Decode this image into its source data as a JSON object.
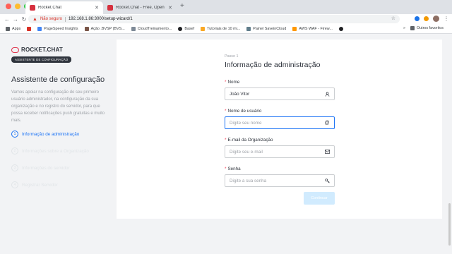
{
  "browser": {
    "tabs": [
      {
        "title": "Rocket.Chat",
        "active": true
      },
      {
        "title": "Rocket.Chat - Free, Open Sou",
        "active": false
      }
    ],
    "not_secure": "Não seguro",
    "url": "192.168.1.86:3000/setup-wizard/1",
    "bookmarks": [
      {
        "label": "Apps",
        "color": "#5f6368"
      },
      {
        "label": "",
        "color": "#d93025"
      },
      {
        "label": "PageSpeed Insights",
        "color": "#4285f4"
      },
      {
        "label": "Ação .BVSP (BVS...",
        "color": "#795548"
      },
      {
        "label": "CloudTreinamento...",
        "color": "#7e8a97"
      },
      {
        "label": "Basef",
        "color": "#202124"
      },
      {
        "label": "Tutoriais de 10 mi...",
        "color": "#f9a825"
      },
      {
        "label": "Painel SaveinCloud",
        "color": "#607d8b"
      },
      {
        "label": "AWS WAF - Firew...",
        "color": "#ff9800"
      },
      {
        "label": "",
        "color": "#202124"
      }
    ],
    "others_label": "Outros favoritos"
  },
  "sidebar": {
    "logo_text": "ROCKET.CHAT",
    "badge": "ASSISTENTE DE CONFIGURAÇÃO",
    "title": "Assistente de configuração",
    "description": "Vamos apoiar na configuração do seu primeiro usuário administrador, na configuração da sua organização e no registro do servidor, para que possa receber notificações push gratuitas e muito mais.",
    "steps": [
      {
        "num": "1",
        "label": "Informação de administração",
        "active": true
      },
      {
        "num": "2",
        "label": "Informações sobre a Organização",
        "active": false
      },
      {
        "num": "3",
        "label": "Informações do servidor",
        "active": false
      },
      {
        "num": "4",
        "label": "Registrar Servidor",
        "active": false
      }
    ]
  },
  "form": {
    "step_label": "Passo 1",
    "title": "Informação de administração",
    "fields": [
      {
        "label": "Nome",
        "value": "João Vitor",
        "placeholder": "",
        "icon": "user-icon"
      },
      {
        "label": "Nome de usuário",
        "value": "",
        "placeholder": "Digite seu nome",
        "icon": "at-icon"
      },
      {
        "label": "E-mail da Organização",
        "value": "",
        "placeholder": "Digite seu e-mail",
        "icon": "mail-icon"
      },
      {
        "label": "Senha",
        "value": "",
        "placeholder": "Digite a sua senha",
        "icon": "key-icon"
      }
    ],
    "continue_label": "Continuar"
  },
  "colors": {
    "accent": "#1d74f5",
    "brand": "#e0364e",
    "required": "#f5455c",
    "button_disabled": "#d1ebfe"
  }
}
